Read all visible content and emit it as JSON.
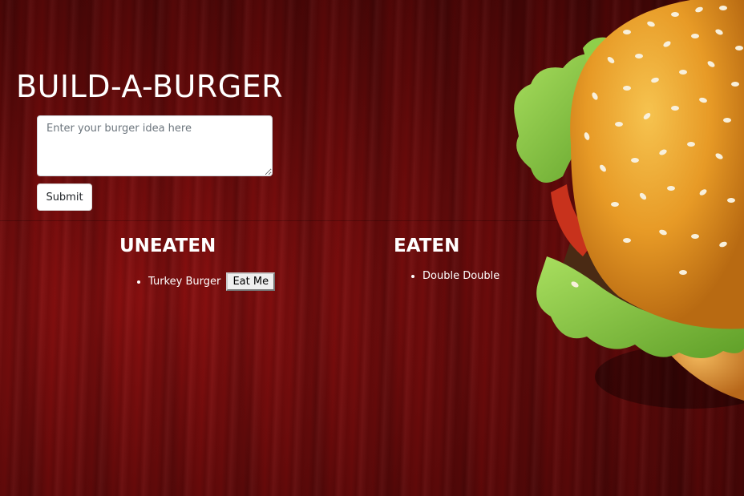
{
  "header": {
    "title": "BUILD-A-BURGER"
  },
  "form": {
    "input_value": "",
    "input_placeholder": "Enter your burger idea here",
    "submit_label": "Submit"
  },
  "uneaten": {
    "heading": "UNEATEN",
    "items": [
      {
        "name": "Turkey Burger",
        "action_label": "Eat Me"
      }
    ]
  },
  "eaten": {
    "heading": "EATEN",
    "items": [
      {
        "name": "Double Double"
      }
    ]
  },
  "theme": {
    "background": "#6a0c0c",
    "text": "#ffffff",
    "bun": "#e8a32c",
    "lettuce": "#7cc23e"
  },
  "decor": {
    "burger_image": "hamburger-photo"
  }
}
